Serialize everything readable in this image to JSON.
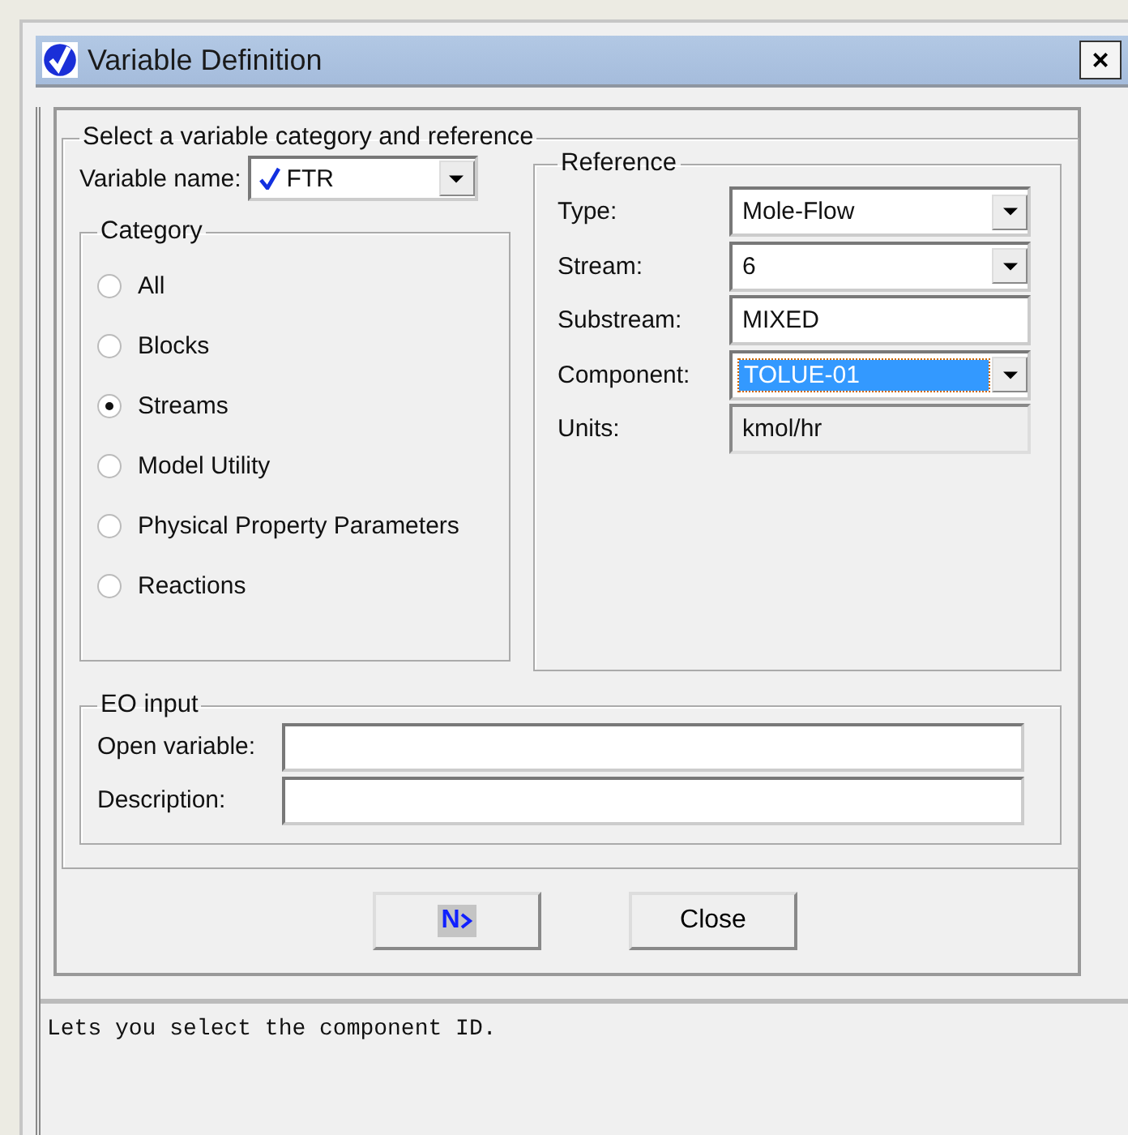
{
  "window": {
    "title": "Variable Definition",
    "close": "×"
  },
  "main_group": {
    "title": "Select a variable category and reference"
  },
  "variable_name": {
    "label": "Variable name:",
    "value": "FTR"
  },
  "category": {
    "title": "Category",
    "options": [
      {
        "label": "All",
        "selected": false
      },
      {
        "label": "Blocks",
        "selected": false
      },
      {
        "label": "Streams",
        "selected": true
      },
      {
        "label": "Model Utility",
        "selected": false
      },
      {
        "label": "Physical Property Parameters",
        "selected": false
      },
      {
        "label": "Reactions",
        "selected": false
      }
    ]
  },
  "reference": {
    "title": "Reference",
    "fields": [
      {
        "label": "Type:",
        "value": "Mole-Flow",
        "kind": "dropdown",
        "focused": false
      },
      {
        "label": "Stream:",
        "value": "6",
        "kind": "dropdown",
        "focused": false
      },
      {
        "label": "Substream:",
        "value": "MIXED",
        "kind": "text",
        "focused": false
      },
      {
        "label": "Component:",
        "value": "TOLUE-01",
        "kind": "dropdown",
        "focused": true
      },
      {
        "label": "Units:",
        "value": "kmol/hr",
        "kind": "readonly",
        "focused": false
      }
    ]
  },
  "eo_input": {
    "title": "EO input",
    "fields": [
      {
        "label": "Open variable:"
      },
      {
        "label": "Description:"
      }
    ]
  },
  "buttons": [
    {
      "label": "N",
      "kind": "next"
    },
    {
      "label": "Close",
      "kind": "text"
    }
  ],
  "prompt": "Lets you select the component ID."
}
